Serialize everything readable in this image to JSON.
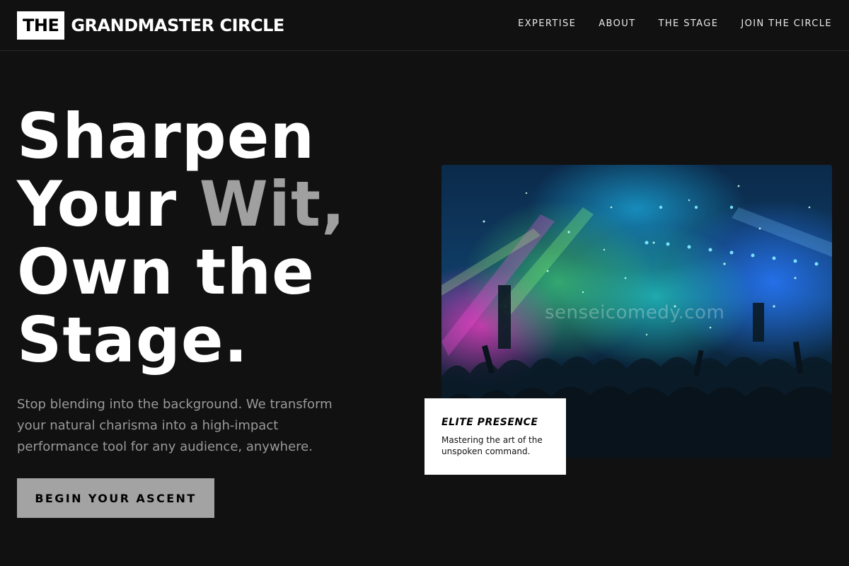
{
  "header": {
    "logo_box": "THE",
    "logo_text": "GRANDMASTER CIRCLE",
    "nav": [
      "EXPERTISE",
      "ABOUT",
      "THE STAGE",
      "JOIN THE CIRCLE"
    ]
  },
  "hero": {
    "line1": "Sharpen",
    "line2_a": "Your ",
    "line2_accent": "Wit,",
    "line3": "Own the",
    "line4": "Stage.",
    "description": "Stop blending into the background. We transform your natural charisma into a high-impact performance tool for any audience, anywhere.",
    "cta_label": "BEGIN YOUR ASCENT"
  },
  "image": {
    "watermark": "senseicomedy.com"
  },
  "card": {
    "title": "ELITE PRESENCE",
    "subtitle": "Mastering the art of the unspoken command."
  },
  "colors": {
    "background": "#111111",
    "accent_text": "#a0a0a0",
    "cta_bg": "#a3a3a3",
    "card_bg": "#ffffff"
  }
}
